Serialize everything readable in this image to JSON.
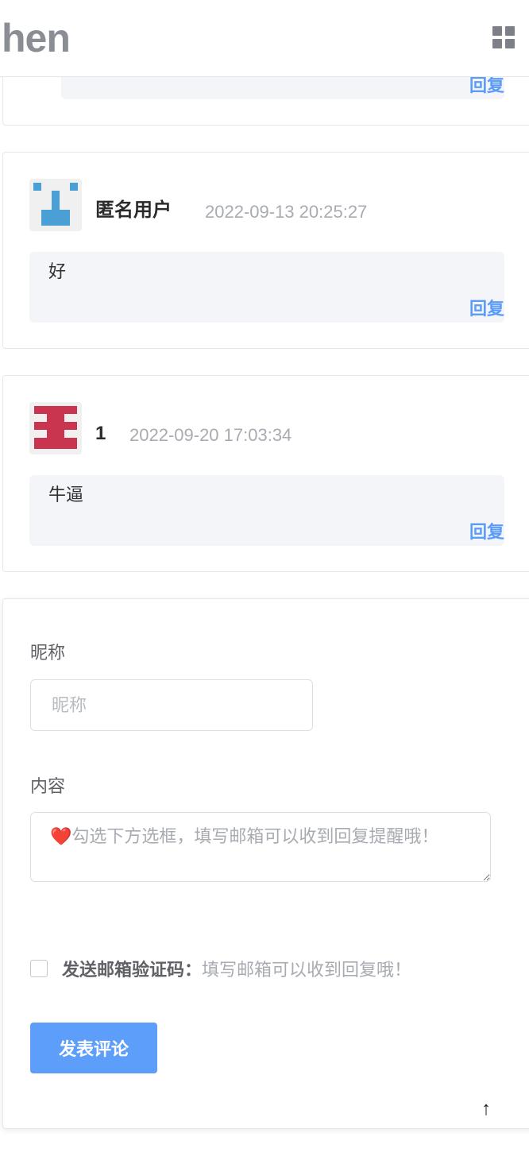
{
  "header": {
    "brand": "hen",
    "menu_icon": "grid-menu-icon"
  },
  "comments": [
    {
      "reply_label": "回复"
    },
    {
      "name": "匿名用户",
      "time": "2022-09-13 20:25:27",
      "content": "好",
      "reply_label": "回复",
      "avatar_color": "#4a9fd5"
    },
    {
      "name": "1",
      "time": "2022-09-20 17:03:34",
      "content": "牛逼",
      "reply_label": "回复",
      "avatar_color": "#c9344e"
    }
  ],
  "form": {
    "nickname_label": "昵称",
    "nickname_placeholder": "昵称",
    "content_label": "内容",
    "content_placeholder": "❤️勾选下方选框，填写邮箱可以收到回复提醒哦！",
    "email_check_label": "发送邮箱验证码：",
    "email_check_hint": "填写邮箱可以收到回复哦！",
    "submit_label": "发表评论",
    "back_to_top": "↑"
  },
  "colors": {
    "accent": "#5c9ef9",
    "reply": "#5a9cf8",
    "bubble_bg": "#f4f5f8"
  }
}
